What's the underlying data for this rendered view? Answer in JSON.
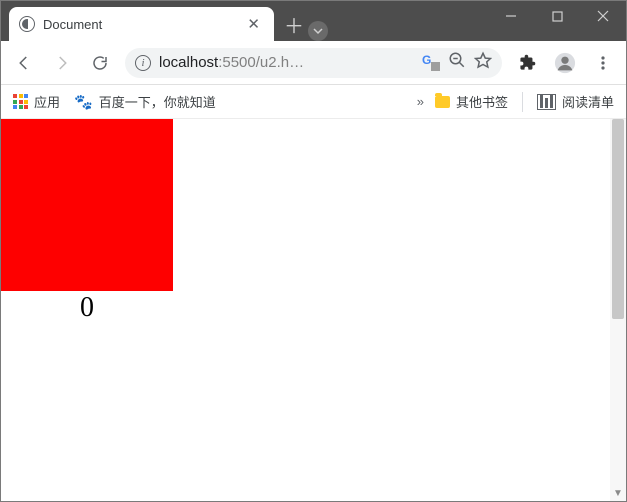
{
  "tab": {
    "title": "Document"
  },
  "omnibox": {
    "host": "localhost",
    "rest": ":5500/u2.h…"
  },
  "bookmarks": {
    "apps": "应用",
    "baidu": "百度一下，你就知道",
    "other": "其他书签",
    "reading": "阅读清单"
  },
  "page": {
    "counter": "0",
    "box_color": "#fe0000"
  }
}
